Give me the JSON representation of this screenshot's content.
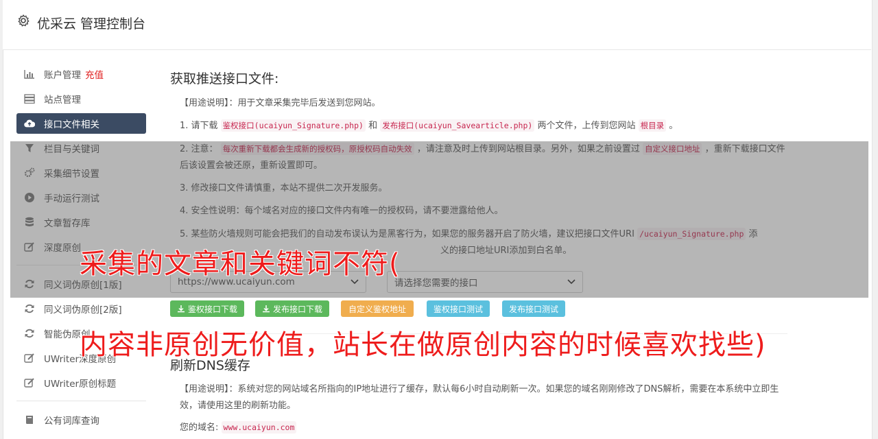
{
  "header": {
    "title": "优采云 管理控制台",
    "icon": "gear-icon"
  },
  "sidebar": {
    "items": [
      {
        "label": "账户管理",
        "extra": "充值",
        "icon": "bar-chart-icon"
      },
      {
        "label": "站点管理",
        "icon": "server-icon"
      },
      {
        "label": "接口文件相关",
        "icon": "cloud-upload-icon",
        "active": true
      },
      {
        "label": "栏目与关键词",
        "icon": "filter-icon"
      },
      {
        "label": "采集细节设置",
        "icon": "cogs-icon"
      },
      {
        "label": "手动运行测试",
        "icon": "play-circle-icon"
      },
      {
        "label": "文章暂存库",
        "icon": "database-icon"
      },
      {
        "label": "深度原创",
        "icon": "edit-icon"
      },
      {
        "label": "同义词伪原创[1版]",
        "icon": "refresh-icon"
      },
      {
        "label": "同义词伪原创[2版]",
        "icon": "refresh-icon"
      },
      {
        "label": "智能伪原创",
        "icon": "refresh-icon"
      },
      {
        "label": "UWriter深度原创",
        "icon": "edit-icon"
      },
      {
        "label": "UWriter原创标题",
        "icon": "edit-icon"
      },
      {
        "label": "公有词库查询",
        "icon": "book-icon"
      }
    ]
  },
  "main": {
    "section1": {
      "title": "获取推送接口文件:",
      "usage": "【用途说明】：用于文章采集完毕后发送到您网站。",
      "item1_pre": "1. 请下载",
      "item1_code1": "鉴权接口(ucaiyun_Signature.php)",
      "item1_mid": "和",
      "item1_code2": "发布接口(ucaiyun_Savearticle.php)",
      "item1_post": "两个文件，上传到您网站",
      "item1_code3": "根目录",
      "item1_end": "。",
      "item2_pre": "2. 注意：",
      "item2_code1": "每次重新下载都会生成新的授权码，原授权码自动失效",
      "item2_mid": "，请注意及时上传到网站根目录。另外，如果之前设置过",
      "item2_code2": "自定义接口地址",
      "item2_post": "，重新下载接口文件后该设置会被还原，重新设置即可。",
      "item3": "3. 修改接口文件请慎重，本站不提供二次开发服务。",
      "item4": "4. 安全性说明：每个域名对应的接口文件内有唯一的授权码，请不要泄露给他人。",
      "item5_pre": "5. 某些防火墙规则可能会把我们的自动发布误认为是黑客行为，如果您的服务器开启了防火墙，建议把接口文件URI",
      "item5_code": "/ucaiyun_Signature.php",
      "item5_post": "添",
      "item5_line2": "义的接口地址URI添加到白名单。",
      "site_select": "https://www.ucaiyun.com",
      "api_select": "请选择您需要的接口",
      "buttons": {
        "sig_download": "鉴权接口下载",
        "pub_download": "发布接口下载",
        "custom_auth": "自定义鉴权地址",
        "sig_test": "鉴权接口测试",
        "pub_test": "发布接口测试"
      }
    },
    "section2": {
      "title": "刷新DNS缓存",
      "usage": "【用途说明】：系统对您的网站域名所指向的IP地址进行了缓存，默认每6小时自动刷新一次。如果您的域名刚刚修改了DNS解析，需要在本系统中立即生效，请使用这里的刷新功能。",
      "domain_label": "您的域名:",
      "domain_value": "www.ucaiyun.com"
    }
  },
  "captions": {
    "line1": "采集的文章和关键词不符(",
    "line2": "内容非原创无价值，站长在做原创内容的时候喜欢找些)"
  }
}
